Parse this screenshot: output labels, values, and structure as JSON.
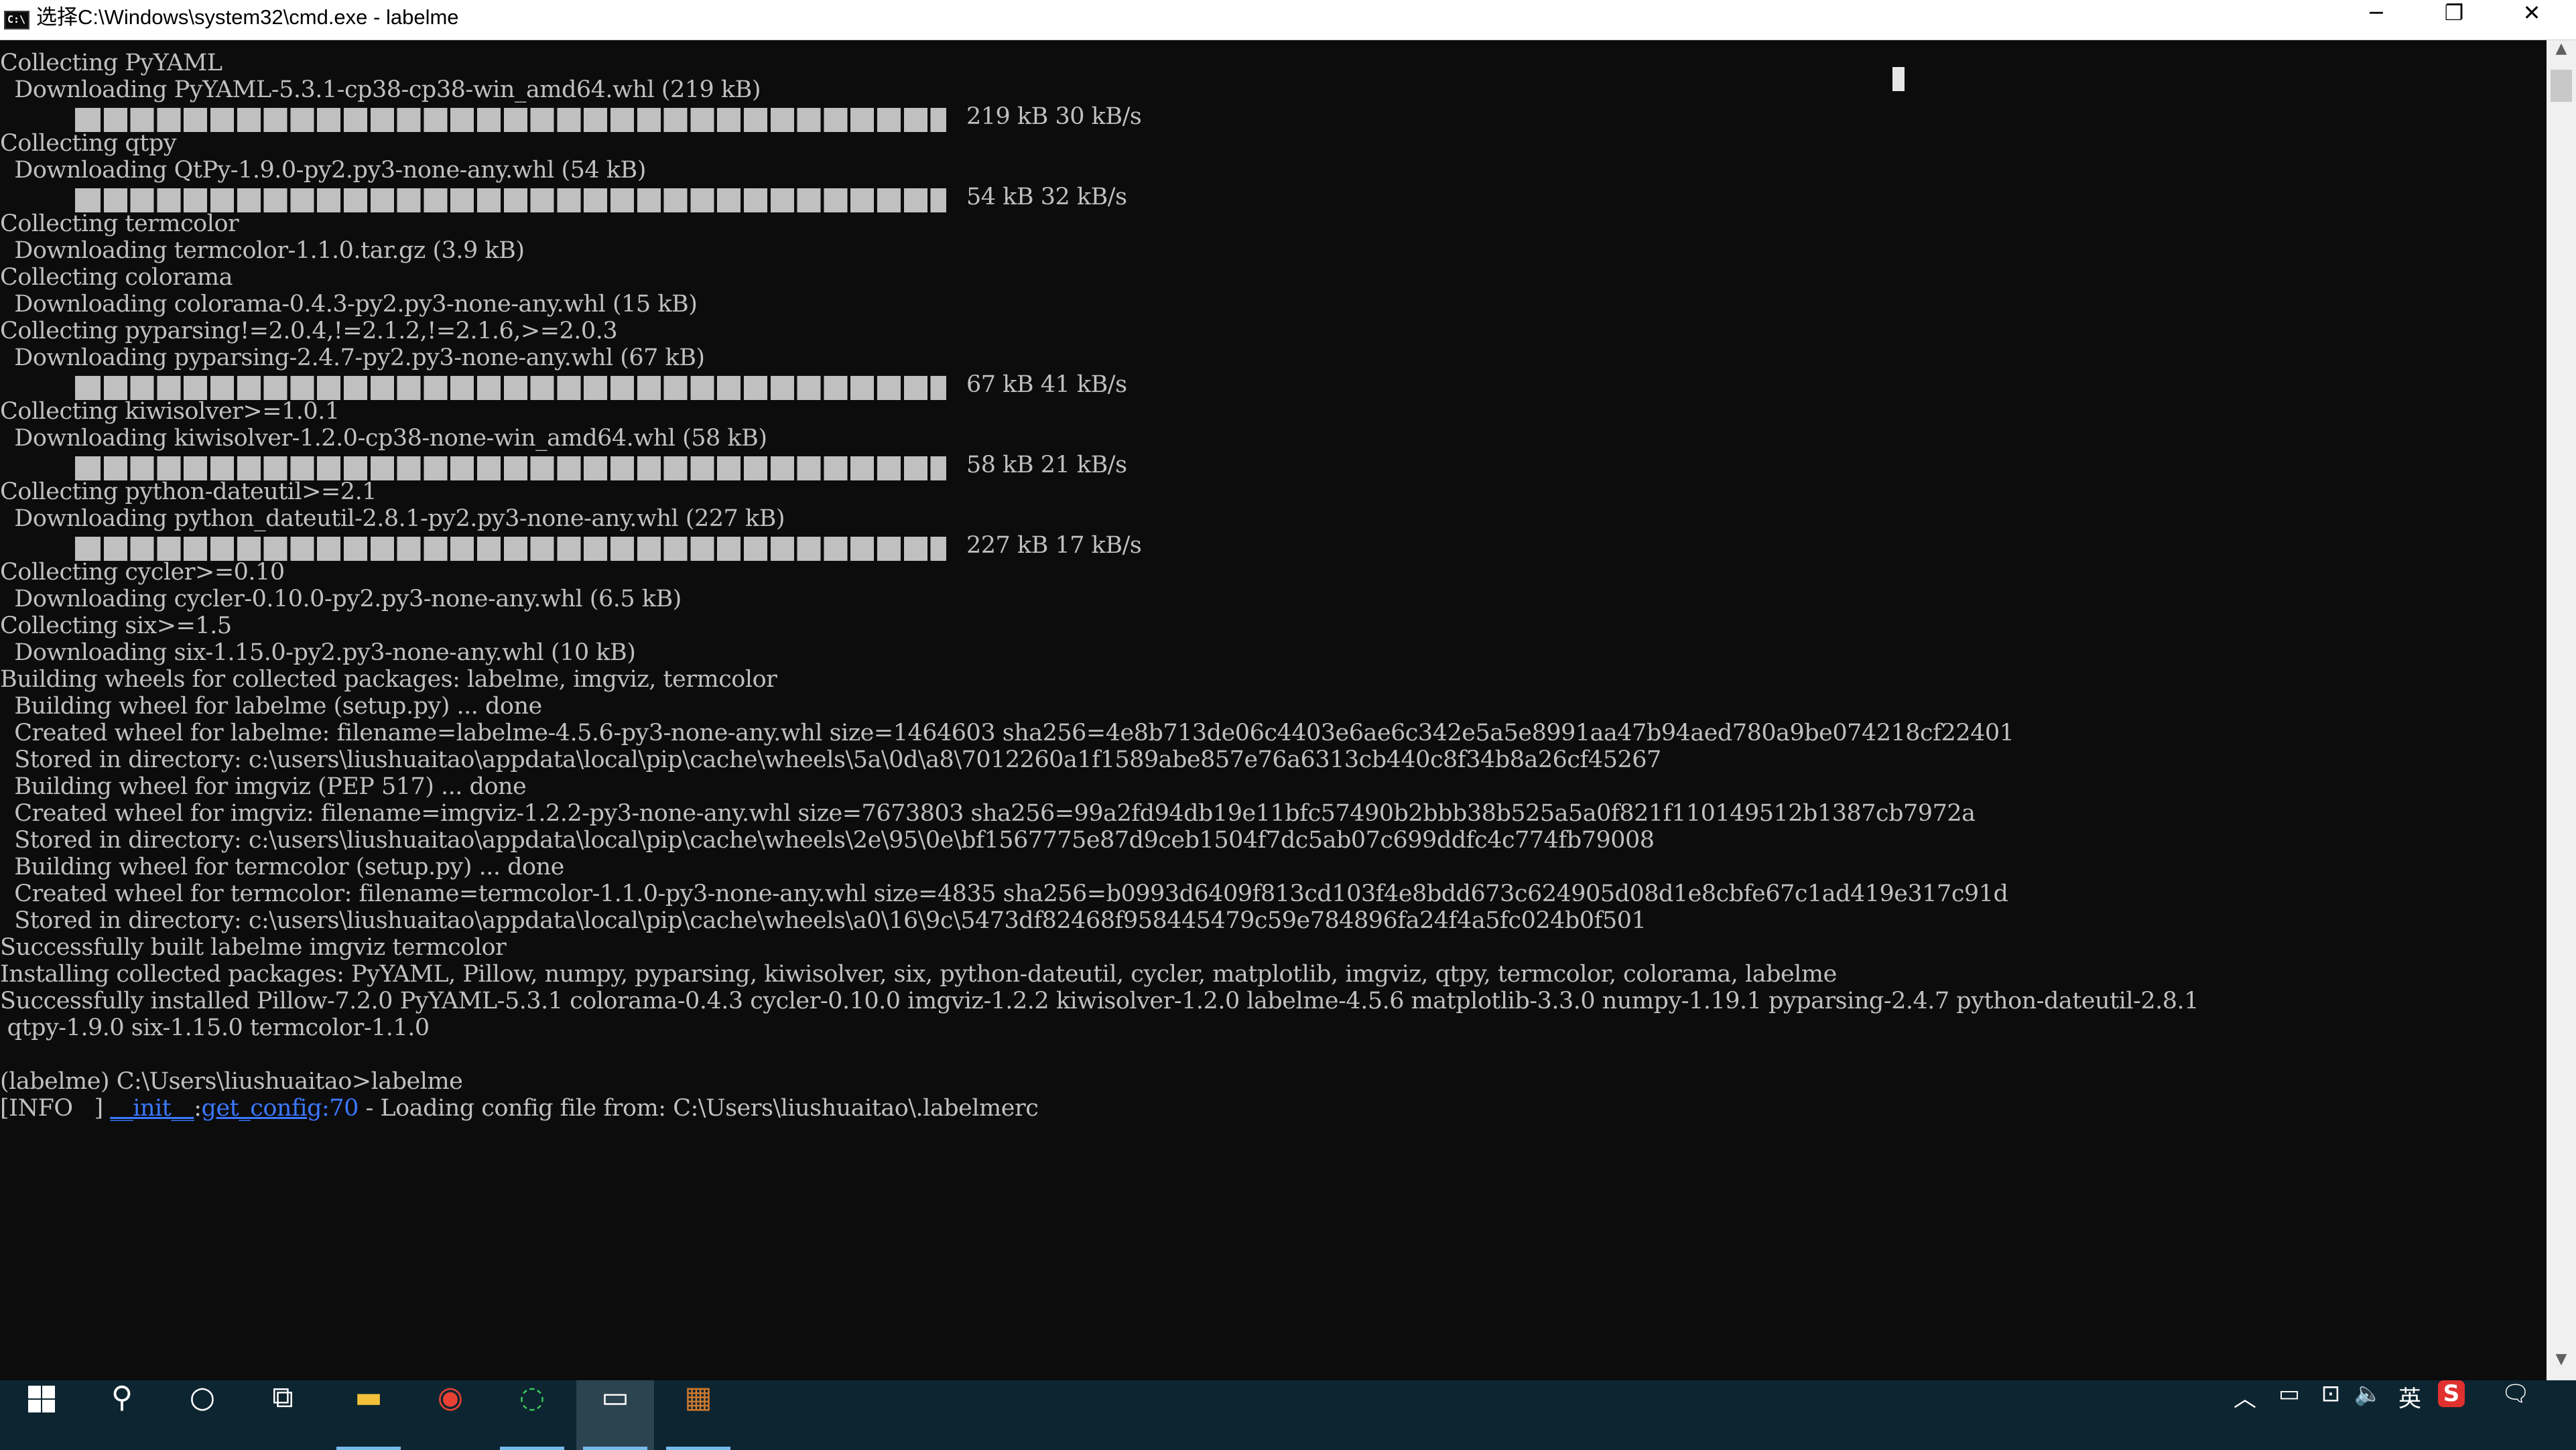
{
  "window": {
    "title": "选择C:\\Windows\\system32\\cmd.exe - labelme",
    "icon_text": "C:\\",
    "icon": "cmd-icon",
    "controls": {
      "minimize": "─",
      "restore": "❐",
      "close": "✕"
    }
  },
  "terminal": {
    "colors": {
      "background": "#0c0c0c",
      "text": "#c0c0c0",
      "info_blue": "#3b78ff"
    },
    "lines": [
      {
        "text": "Collecting PyYAML"
      },
      {
        "text": "  Downloading PyYAML-5.3.1-cp38-cp38-win_amd64.whl (219 kB)"
      },
      {
        "progress": 1.0,
        "text": "219 kB 30 kB/s"
      },
      {
        "text": "Collecting qtpy"
      },
      {
        "text": "  Downloading QtPy-1.9.0-py2.py3-none-any.whl (54 kB)"
      },
      {
        "progress": 1.0,
        "text": "54 kB 32 kB/s"
      },
      {
        "text": "Collecting termcolor"
      },
      {
        "text": "  Downloading termcolor-1.1.0.tar.gz (3.9 kB)"
      },
      {
        "text": "Collecting colorama"
      },
      {
        "text": "  Downloading colorama-0.4.3-py2.py3-none-any.whl (15 kB)"
      },
      {
        "text": "Collecting pyparsing!=2.0.4,!=2.1.2,!=2.1.6,>=2.0.3"
      },
      {
        "text": "  Downloading pyparsing-2.4.7-py2.py3-none-any.whl (67 kB)"
      },
      {
        "progress": 1.0,
        "text": "67 kB 41 kB/s"
      },
      {
        "text": "Collecting kiwisolver>=1.0.1"
      },
      {
        "text": "  Downloading kiwisolver-1.2.0-cp38-none-win_amd64.whl (58 kB)"
      },
      {
        "progress": 1.0,
        "text": "58 kB 21 kB/s"
      },
      {
        "text": "Collecting python-dateutil>=2.1"
      },
      {
        "text": "  Downloading python_dateutil-2.8.1-py2.py3-none-any.whl (227 kB)"
      },
      {
        "progress": 1.0,
        "text": "227 kB 17 kB/s"
      },
      {
        "text": "Collecting cycler>=0.10"
      },
      {
        "text": "  Downloading cycler-0.10.0-py2.py3-none-any.whl (6.5 kB)"
      },
      {
        "text": "Collecting six>=1.5"
      },
      {
        "text": "  Downloading six-1.15.0-py2.py3-none-any.whl (10 kB)"
      },
      {
        "text": "Building wheels for collected packages: labelme, imgviz, termcolor"
      },
      {
        "text": "  Building wheel for labelme (setup.py) ... done"
      },
      {
        "text": "  Created wheel for labelme: filename=labelme-4.5.6-py3-none-any.whl size=1464603 sha256=4e8b713de06c4403e6ae6c342e5a5e8991aa47b94aed780a9be074218cf22401"
      },
      {
        "text": "  Stored in directory: c:\\users\\liushuaitao\\appdata\\local\\pip\\cache\\wheels\\5a\\0d\\a8\\7012260a1f1589abe857e76a6313cb440c8f34b8a26cf45267"
      },
      {
        "text": "  Building wheel for imgviz (PEP 517) ... done"
      },
      {
        "text": "  Created wheel for imgviz: filename=imgviz-1.2.2-py3-none-any.whl size=7673803 sha256=99a2fd94db19e11bfc57490b2bbb38b525a5a0f821f110149512b1387cb7972a"
      },
      {
        "text": "  Stored in directory: c:\\users\\liushuaitao\\appdata\\local\\pip\\cache\\wheels\\2e\\95\\0e\\bf1567775e87d9ceb1504f7dc5ab07c699ddfc4c774fb79008"
      },
      {
        "text": "  Building wheel for termcolor (setup.py) ... done"
      },
      {
        "text": "  Created wheel for termcolor: filename=termcolor-1.1.0-py3-none-any.whl size=4835 sha256=b0993d6409f813cd103f4e8bdd673c624905d08d1e8cbfe67c1ad419e317c91d"
      },
      {
        "text": "  Stored in directory: c:\\users\\liushuaitao\\appdata\\local\\pip\\cache\\wheels\\a0\\16\\9c\\5473df82468f958445479c59e784896fa24f4a5fc024b0f501"
      },
      {
        "text": "Successfully built labelme imgviz termcolor"
      },
      {
        "text": "Installing collected packages: PyYAML, Pillow, numpy, pyparsing, kiwisolver, six, python-dateutil, cycler, matplotlib, imgviz, qtpy, termcolor, colorama, labelme"
      },
      {
        "text": "Successfully installed Pillow-7.2.0 PyYAML-5.3.1 colorama-0.4.3 cycler-0.10.0 imgviz-1.2.2 kiwisolver-1.2.0 labelme-4.5.6 matplotlib-3.3.0 numpy-1.19.1 pyparsing-2.4.7 python-dateutil-2.8.1"
      },
      {
        "text": " qtpy-1.9.0 six-1.15.0 termcolor-1.1.0"
      },
      {
        "text": ""
      },
      {
        "text": "(labelme) C:\\Users\\liushuaitao>labelme"
      },
      {
        "info": true,
        "prefix": "[INFO   ] ",
        "link1": "__init__",
        "colon": ":",
        "link2": "get_config",
        "colon2": ":",
        "lineno": "70",
        "rest": " - Loading config file from: C:\\Users\\liushuaitao\\.labelmerc"
      }
    ]
  },
  "scrollbar": {
    "up": "▲",
    "down": "▼"
  },
  "taskbar": {
    "items": [
      {
        "name": "start-button",
        "icon": "windows-logo-icon",
        "glyph": ""
      },
      {
        "name": "search-button",
        "icon": "search-icon",
        "glyph": "⚲"
      },
      {
        "name": "cortana-button",
        "icon": "cortana-circle-icon",
        "glyph": "○"
      },
      {
        "name": "task-view-button",
        "icon": "task-view-icon",
        "glyph": "⧉"
      },
      {
        "name": "file-explorer-button",
        "icon": "folder-icon",
        "glyph": "▬",
        "color": "#f3c13a",
        "running": true
      },
      {
        "name": "chrome-button",
        "icon": "chrome-icon",
        "glyph": "◉",
        "color": "#e94235"
      },
      {
        "name": "app-green-button",
        "icon": "green-ring-icon",
        "glyph": "◌",
        "color": "#3ec65b",
        "running": true
      },
      {
        "name": "cmd-button",
        "icon": "terminal-icon",
        "glyph": "▭",
        "active": true
      },
      {
        "name": "labelme-button",
        "icon": "labelme-icon",
        "glyph": "▦",
        "color": "#d07a2e",
        "running": true
      }
    ],
    "tray": [
      {
        "name": "show-hidden-icons-button",
        "icon": "chevron-up-icon",
        "glyph": "︿"
      },
      {
        "name": "battery-tray-icon",
        "icon": "battery-icon",
        "glyph": "▭"
      },
      {
        "name": "network-tray-icon",
        "icon": "network-icon",
        "glyph": "⊡"
      },
      {
        "name": "volume-tray-icon",
        "icon": "speaker-icon",
        "glyph": "🔈"
      },
      {
        "name": "ime-language-indicator",
        "icon": "ime-icon",
        "glyph": "英"
      },
      {
        "name": "sogou-ime-tray-icon",
        "icon": "sogou-s-icon",
        "glyph": "S",
        "color": "#e0312f"
      },
      {
        "name": "action-center-button",
        "icon": "notification-icon",
        "glyph": "🗨"
      }
    ]
  }
}
